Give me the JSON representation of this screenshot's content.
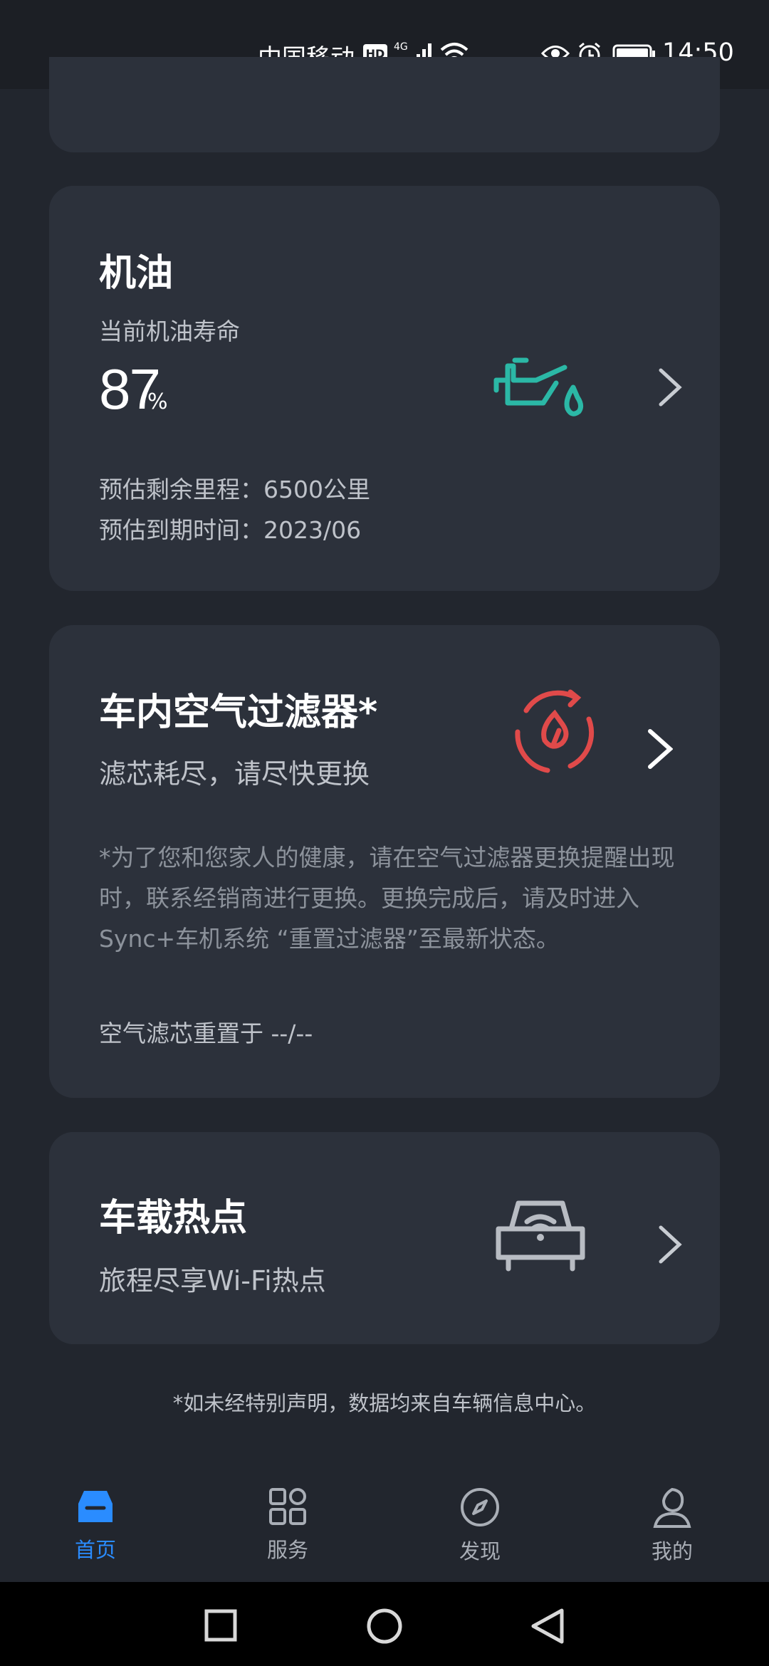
{
  "status_bar": {
    "carrier": "中国移动",
    "hd": "HD",
    "network": "4G",
    "time": "14:50"
  },
  "oil": {
    "title": "机油",
    "subtitle": "当前机油寿命",
    "value": "87",
    "unit": "%",
    "range_line": "预估剩余里程：6500公里",
    "due_line": "预估到期时间：2023/06"
  },
  "air_filter": {
    "title": "车内空气过滤器*",
    "subtitle": "滤芯耗尽，请尽快更换",
    "note": "*为了您和您家人的健康，请在空气过滤器更换提醒出现时，联系经销商进行更换。更换完成后，请及时进入Sync+车机系统 “重置过滤器”至最新状态。",
    "reset_line": "空气滤芯重置于 --/--"
  },
  "hotspot": {
    "title": "车载热点",
    "subtitle": "旅程尽享Wi-Fi热点"
  },
  "footer_note": "*如未经特别声明，数据均来自车辆信息中心。",
  "bottom_nav": [
    {
      "label": "首页",
      "icon": "car-icon",
      "active": true
    },
    {
      "label": "服务",
      "icon": "grid-icon",
      "active": false
    },
    {
      "label": "发现",
      "icon": "compass-icon",
      "active": false
    },
    {
      "label": "我的",
      "icon": "person-icon",
      "active": false
    }
  ],
  "colors": {
    "accent": "#2a8cff",
    "oil_icon": "#2bb8a6",
    "alert_icon": "#e04a4a",
    "card_bg": "#2c313b",
    "page_bg": "#22262e"
  }
}
